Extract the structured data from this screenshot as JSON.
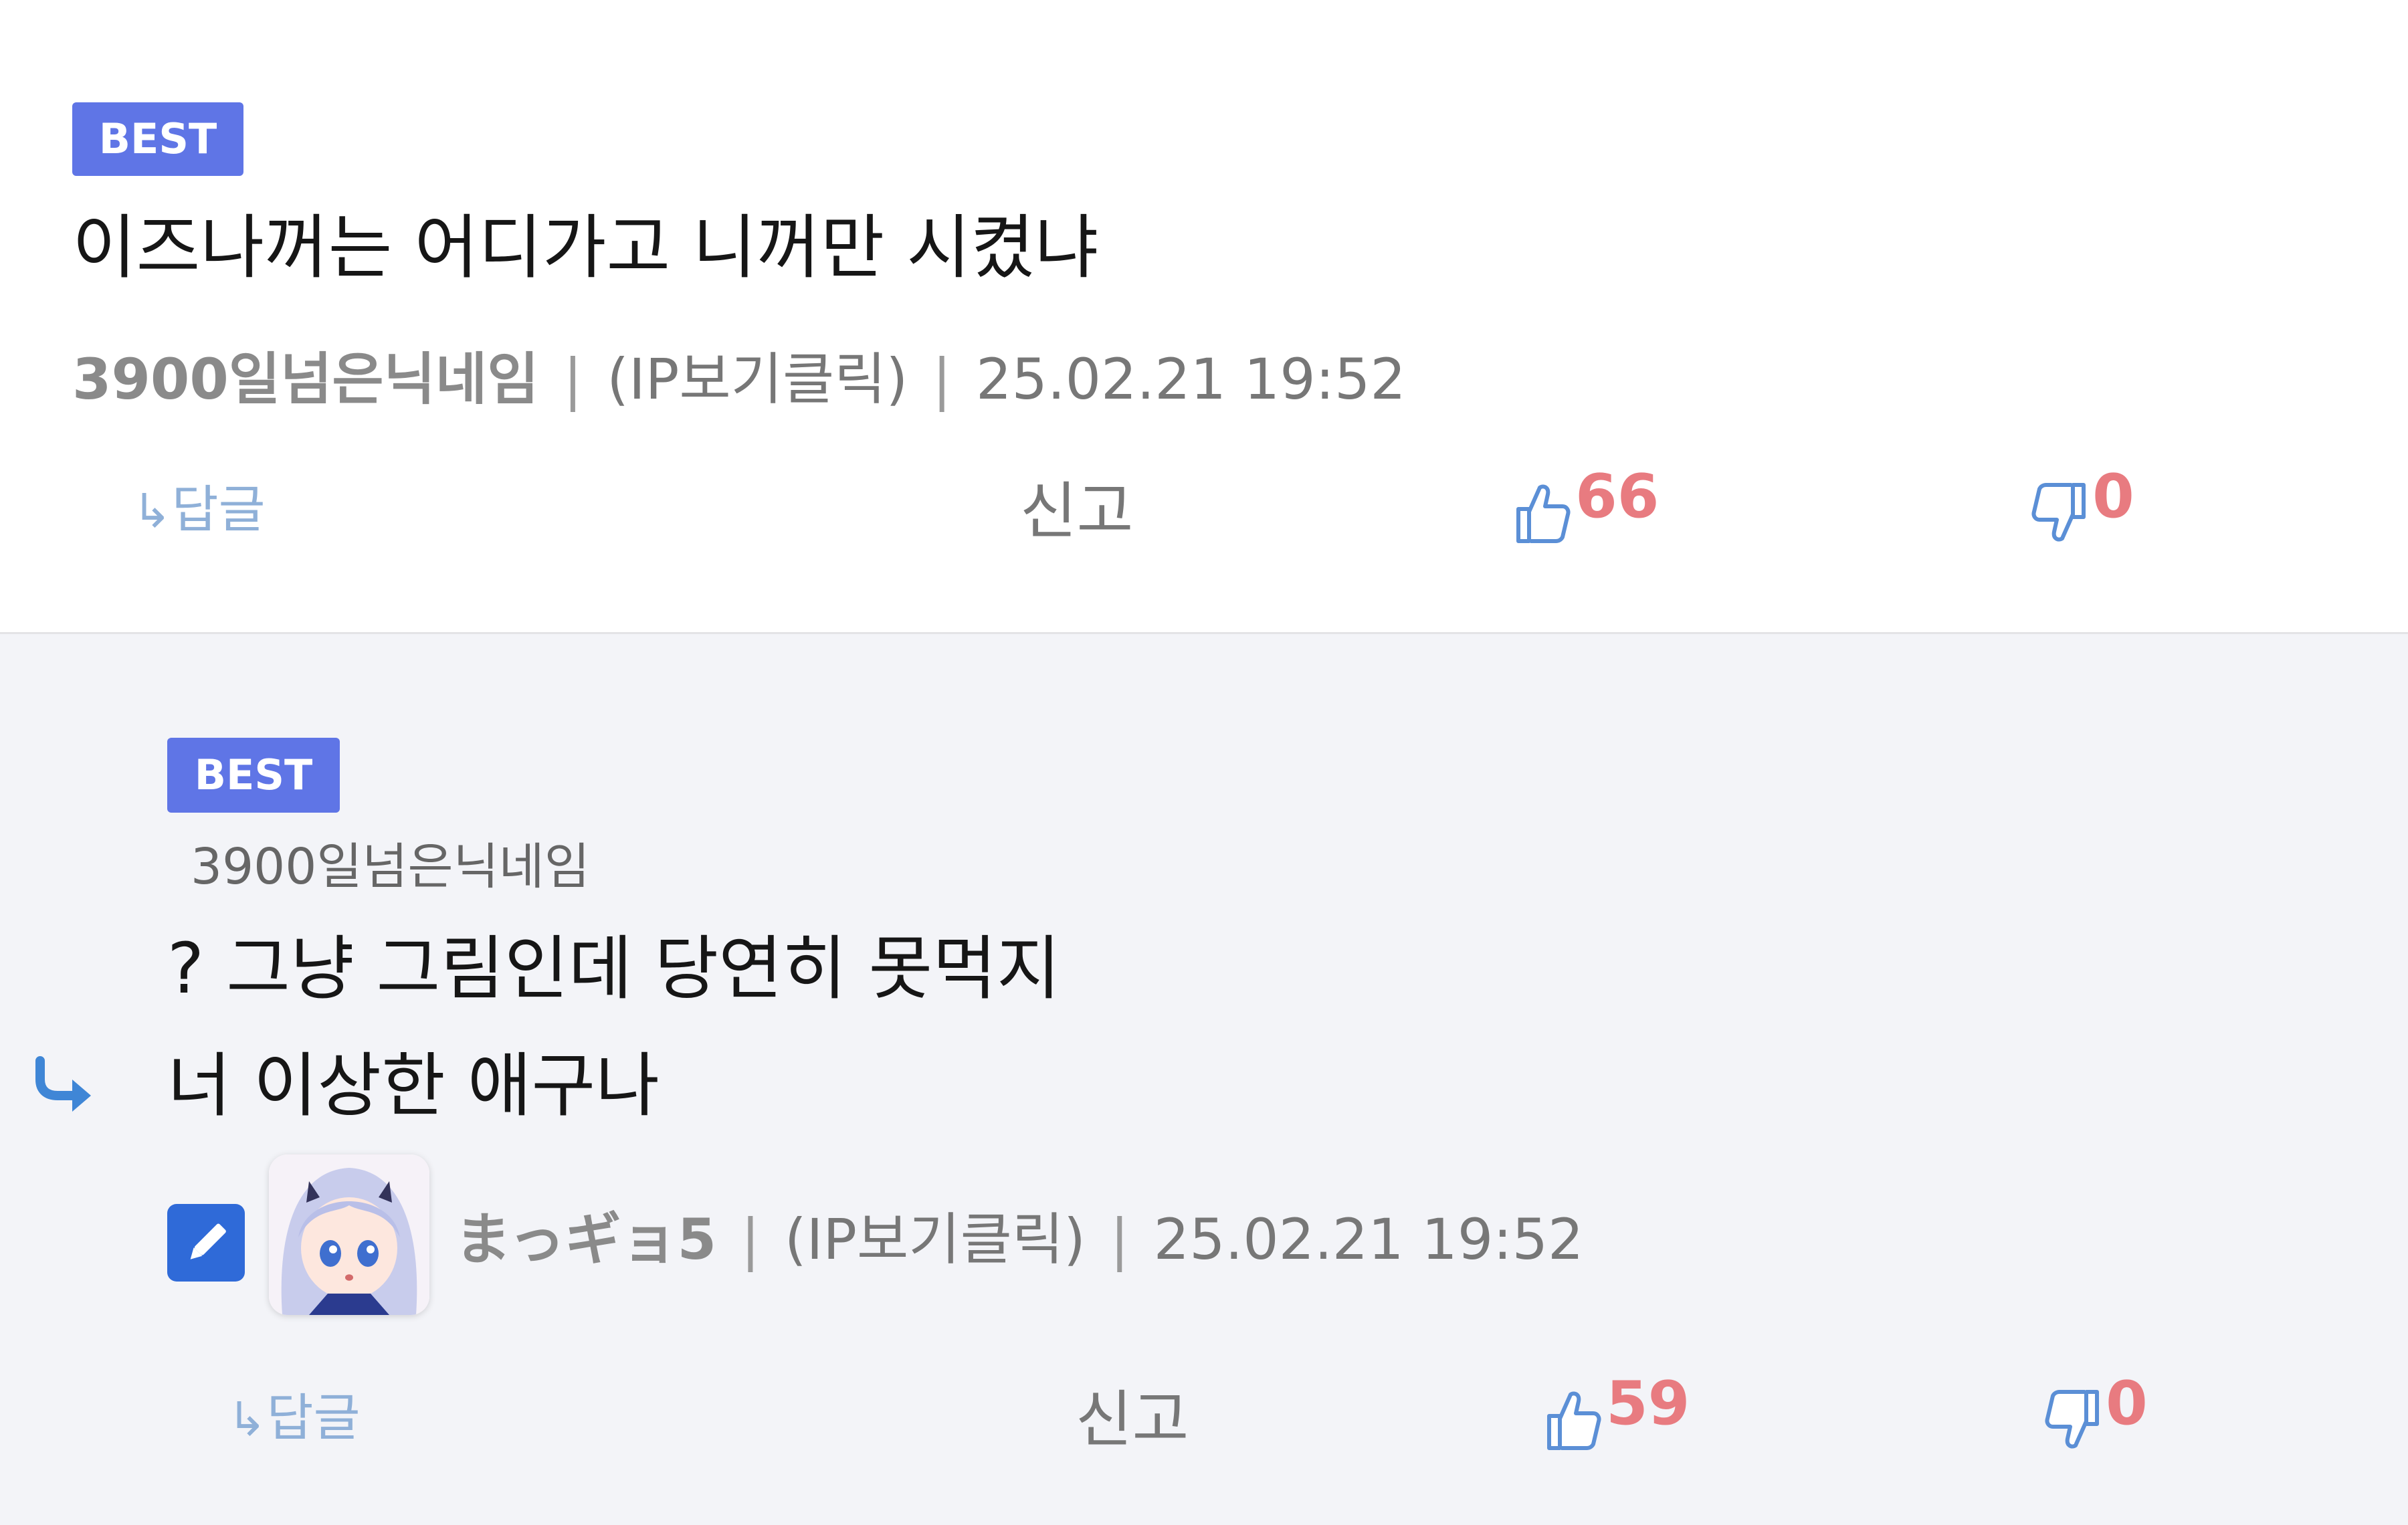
{
  "comments": [
    {
      "badge": "BEST",
      "text": "이즈나꺼는 어디가고 니꺼만 시켰냐",
      "author": "3900일넘은닉네임",
      "ip": "(IP보기클릭)",
      "datetime": "25.02.21 19:52",
      "reply_label": "답글",
      "report_label": "신고",
      "likes": "66",
      "dislikes": "0"
    },
    {
      "badge": "BEST",
      "reply_to": "3900일넘은닉네임",
      "text_lines": [
        "? 그냥 그림인데 당연히 못먹지",
        "너 이상한 애구나"
      ],
      "author": "まっギョ5",
      "ip": "(IP보기클릭)",
      "datetime": "25.02.21 19:52",
      "reply_label": "답글",
      "report_label": "신고",
      "likes": "59",
      "dislikes": "0"
    }
  ],
  "separator": "|",
  "reply_arrow": "↳",
  "colors": {
    "best_badge": "#5f75e6",
    "count": "#e87b80",
    "reply_area_bg": "#f3f4f8",
    "edit_icon_bg": "#2f6ad8",
    "reply_arrow": "#3f86d6"
  },
  "icons": {
    "like": "thumbs-up-icon",
    "dislike": "thumbs-down-icon",
    "reply": "reply-arrow-icon",
    "edit": "pencil-icon",
    "avatar": "anime-character-avatar"
  }
}
